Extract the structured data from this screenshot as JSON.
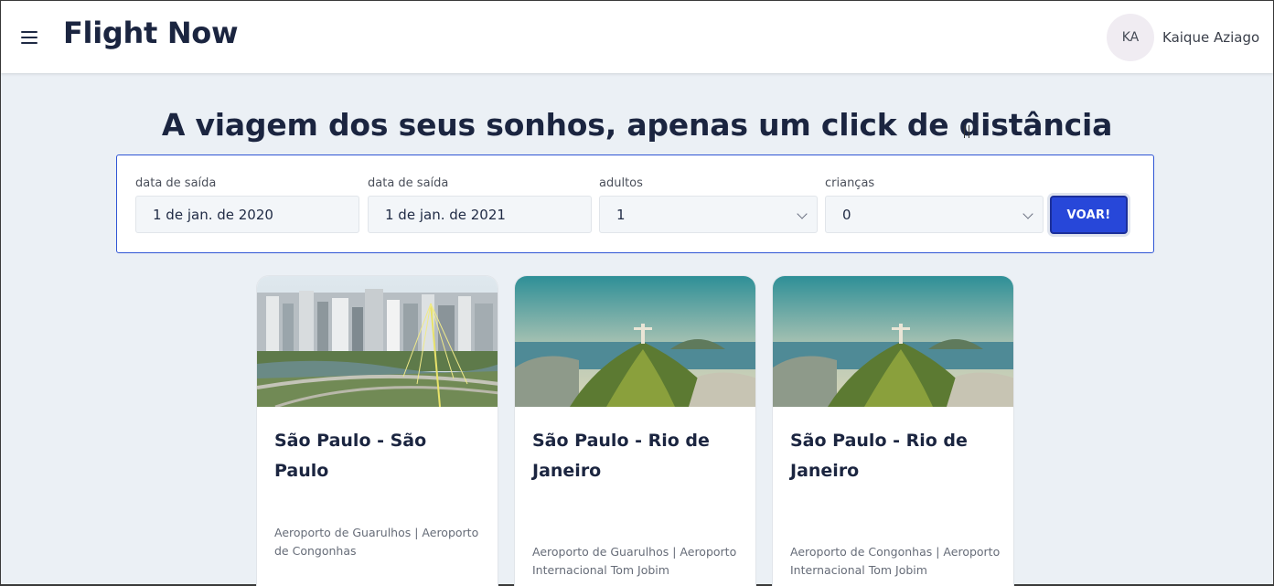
{
  "app": {
    "title": "Flight Now"
  },
  "user": {
    "initials": "KA",
    "name": "Kaique Aziago"
  },
  "hero": {
    "headline": "A viagem dos seus sonhos, apenas um click de distância"
  },
  "search": {
    "departure": {
      "label": "data de saída",
      "value": "1 de jan. de 2020"
    },
    "return": {
      "label": "data de saída",
      "value": "1 de jan. de 2021"
    },
    "adults": {
      "label": "adultos",
      "value": "1"
    },
    "children": {
      "label": "crianças",
      "value": "0"
    },
    "submit_label": "VOAR!"
  },
  "cards": [
    {
      "title": "São Paulo - São Paulo",
      "airports": "Aeroporto de Guarulhos | Aeroporto de Congonhas",
      "image": "sao-paulo-bridge"
    },
    {
      "title": "São Paulo - Rio de Janeiro",
      "airports": "Aeroporto de Guarulhos | Aeroporto Internacional Tom Jobim",
      "image": "rio-christ-redeemer"
    },
    {
      "title": "São Paulo - Rio de Janeiro",
      "airports": "Aeroporto de Congonhas | Aeroporto Internacional Tom Jobim",
      "image": "rio-christ-redeemer"
    }
  ],
  "colors": {
    "accent": "#2747d9",
    "background": "#ebf0f5",
    "text": "#1b2540"
  },
  "icons": {
    "menu": "menu-icon",
    "select_arrow": "chevron-down-icon"
  }
}
